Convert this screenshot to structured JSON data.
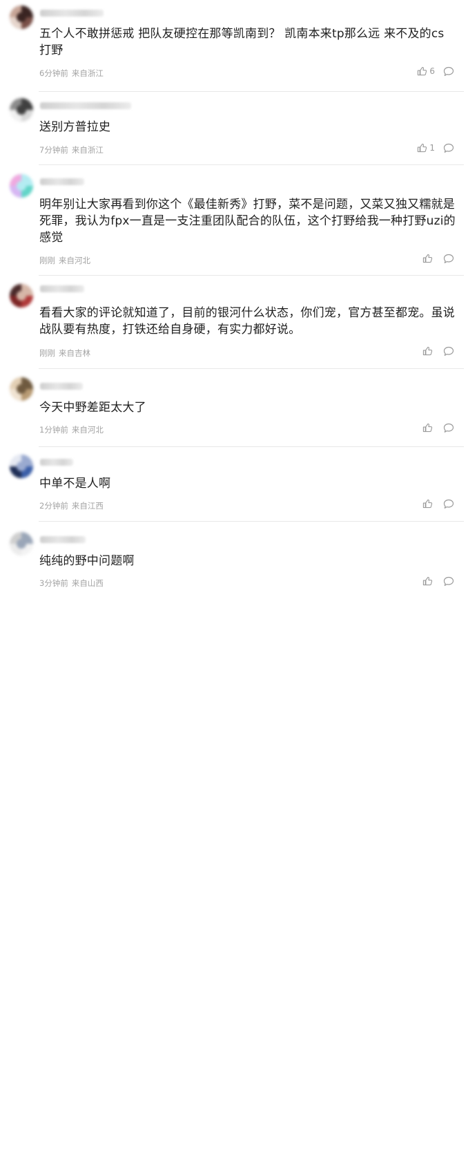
{
  "comments": [
    {
      "text": "五个人不敢拼惩戒 把队友硬控在那等凯南到？ 凯南本来tp那么远 来不及的cs打野",
      "time": "6分钟前",
      "location": "来自浙江",
      "likes": "6",
      "avatar_colors": [
        "#7a5048",
        "#c7a597",
        "#3a2422",
        "#e6d5cc"
      ]
    },
    {
      "text": "送别方普拉史",
      "time": "7分钟前",
      "location": "来自浙江",
      "likes": "1",
      "avatar_colors": [
        "#d8d8d8",
        "#8c8c8c",
        "#404040",
        "#f1f1f1"
      ]
    },
    {
      "text": "明年别让大家再看到你这个《最佳新秀》打野，菜不是问题，又菜又独又糯就是死罪，我认为fpx一直是一支注重团队配合的队伍，这个打野给我一种打野uzi的感觉",
      "time": "刚刚",
      "location": "来自河北",
      "likes": "",
      "avatar_colors": [
        "#62d5c8",
        "#f0a9e0",
        "#b4ecf2",
        "#d7b6f3"
      ]
    },
    {
      "text": "看看大家的评论就知道了，目前的银河什么状态，你们宠，官方甚至都宠。虽说战队要有热度，打铁还给自身硬，有实力都好说。",
      "time": "刚刚",
      "location": "来自吉林",
      "likes": "",
      "avatar_colors": [
        "#b03a3a",
        "#4a2a2a",
        "#d6b7a8",
        "#7d2525"
      ]
    },
    {
      "text": "今天中野差距太大了",
      "time": "1分钟前",
      "location": "来自河北",
      "likes": "",
      "avatar_colors": [
        "#b89b74",
        "#e3cfb4",
        "#6f5a3f",
        "#f0e3d2"
      ]
    },
    {
      "text": "中单不是人啊",
      "time": "2分钟前",
      "location": "来自江西",
      "likes": "",
      "avatar_colors": [
        "#3b5fa8",
        "#e6e9f2",
        "#9aaad0",
        "#1f2e55"
      ]
    },
    {
      "text": "纯纯的野中问题啊",
      "time": "3分钟前",
      "location": "来自山西",
      "likes": "",
      "avatar_colors": [
        "#f3f3f3",
        "#cfcfcf",
        "#9aa6b8",
        "#ececec"
      ]
    }
  ]
}
